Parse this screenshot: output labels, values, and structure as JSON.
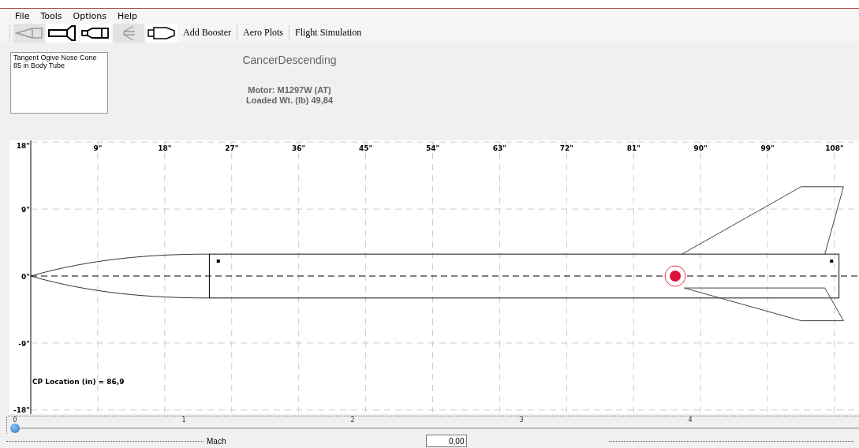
{
  "menu": [
    "File",
    "Tools",
    "Options",
    "Help"
  ],
  "toolbar": {
    "icons": [
      {
        "kind": "nose",
        "disabled": true
      },
      {
        "kind": "finned",
        "disabled": false
      },
      {
        "kind": "transition",
        "disabled": false
      },
      {
        "kind": "fin",
        "disabled": true
      },
      {
        "kind": "boattail",
        "disabled": false
      }
    ],
    "buttons": [
      "Add Booster",
      "Aero Plots",
      "Flight Simulation"
    ]
  },
  "components": [
    "Tangent Ogive Nose Cone",
    "85 in Body Tube"
  ],
  "rocket_name": "CancerDescending",
  "motor": "Motor: M1297W  (AT)",
  "loaded_weight": "Loaded Wt. (lb) 49,84",
  "plot": {
    "x_ticks": [
      "9\"",
      "18\"",
      "27\"",
      "36\"",
      "45\"",
      "54\"",
      "63\"",
      "72\"",
      "81\"",
      "90\"",
      "99\"",
      "108\""
    ],
    "y_ticks": [
      "18\"",
      "9\"",
      "0\"",
      "-9\"",
      "-18\""
    ],
    "cp_label": "CP Location (in) = 86,9"
  },
  "mach": {
    "ticks": [
      "0",
      "1",
      "2",
      "3",
      "4"
    ],
    "level": 0,
    "label": "Mach",
    "value": "0,00"
  }
}
